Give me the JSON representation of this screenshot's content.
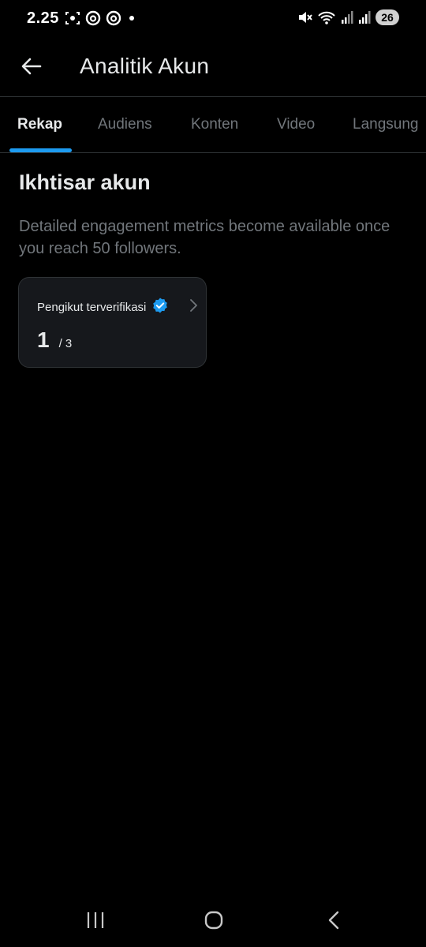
{
  "status_bar": {
    "time": "2.25",
    "battery": "26",
    "icons": [
      "screenshot-icon",
      "threads-icon",
      "threads-icon",
      "dot-icon",
      "mute-icon",
      "wifi-icon",
      "signal-icon",
      "signal-icon",
      "battery-icon"
    ]
  },
  "header": {
    "title": "Analitik Akun",
    "back_icon": "arrow-left-icon"
  },
  "tabs": [
    {
      "label": "Rekap",
      "active": true
    },
    {
      "label": "Audiens",
      "active": false
    },
    {
      "label": "Konten",
      "active": false
    },
    {
      "label": "Video",
      "active": false
    },
    {
      "label": "Langsung",
      "active": false
    }
  ],
  "overview": {
    "title": "Ikhtisar akun",
    "description": "Detailed engagement metrics become available once you reach 50 followers."
  },
  "metric_card": {
    "label": "Pengikut terverifikasi",
    "value": "1",
    "total": "/ 3",
    "badge_icon": "verified-badge-icon",
    "chevron_icon": "chevron-right-icon"
  },
  "nav_bar": {
    "items": [
      "recent-apps-icon",
      "home-icon",
      "back-icon"
    ]
  },
  "colors": {
    "background": "#000000",
    "accent": "#1d9bf0",
    "text_primary": "#e7e9ea",
    "text_secondary": "#71767b",
    "divider": "#2f3336",
    "card_background": "#16181c"
  }
}
